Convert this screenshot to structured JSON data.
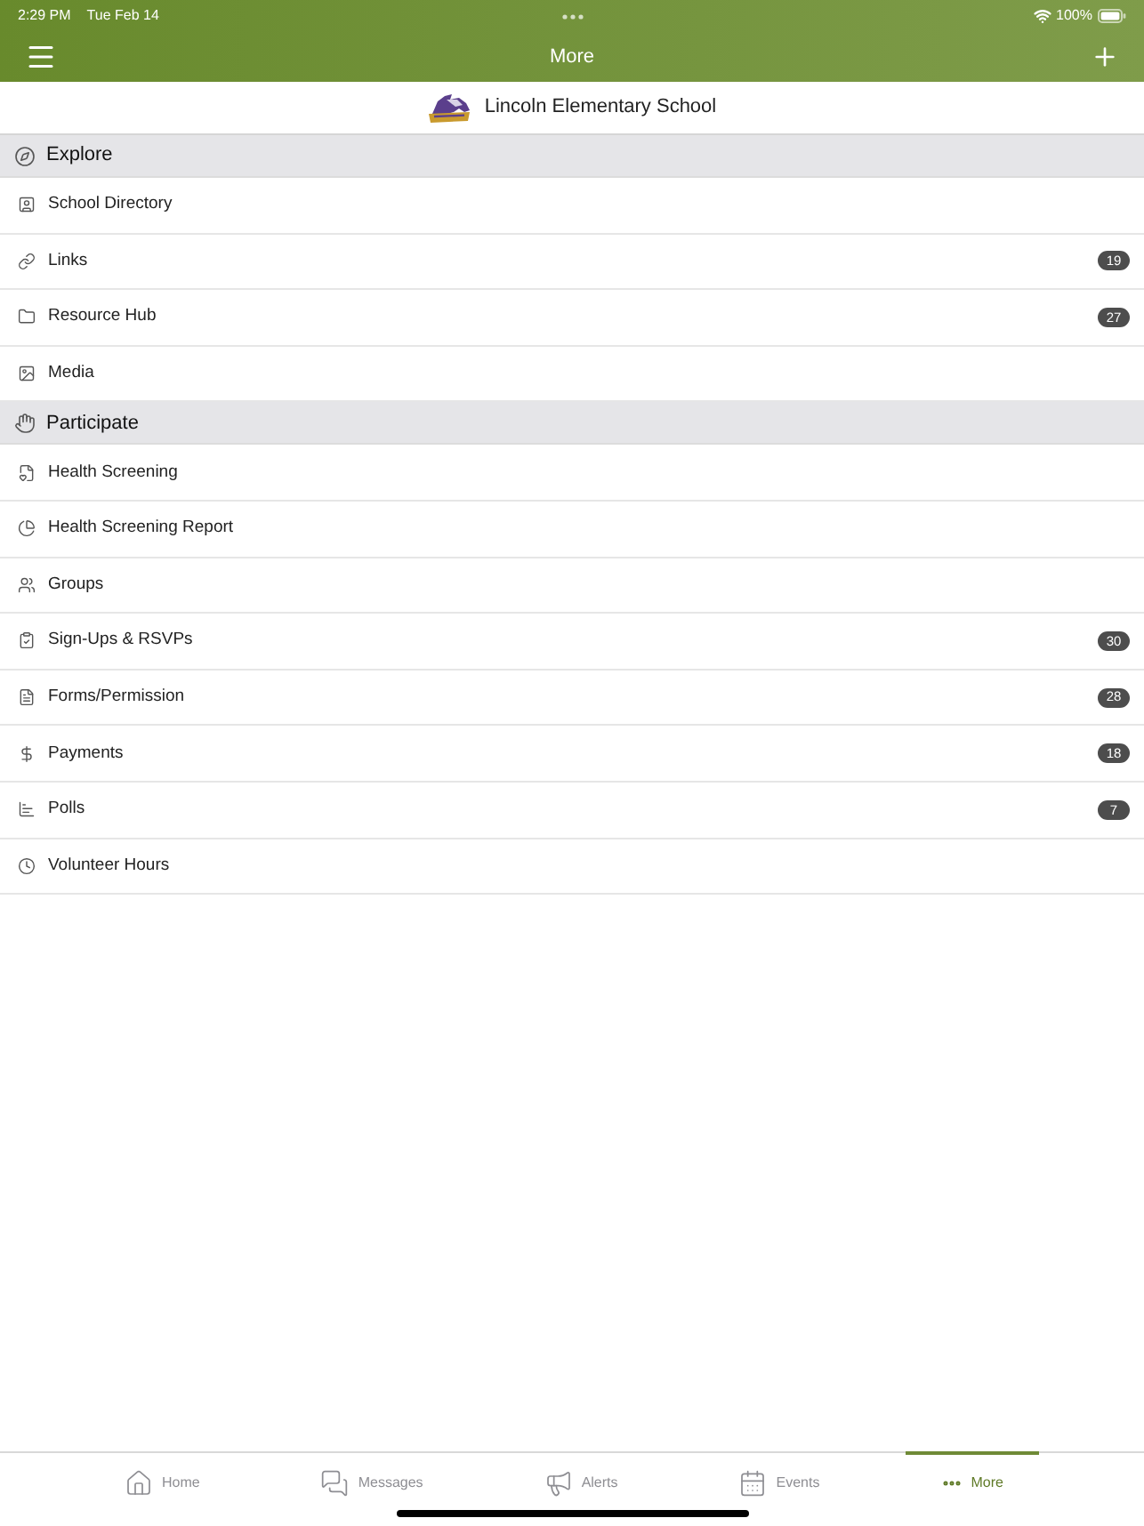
{
  "status_bar": {
    "time": "2:29 PM",
    "date": "Tue Feb 14",
    "battery": "100%"
  },
  "nav_bar": {
    "title": "More"
  },
  "school": {
    "name": "Lincoln Elementary School"
  },
  "sections": [
    {
      "title": "Explore",
      "items": [
        {
          "label": "School Directory"
        },
        {
          "label": "Links",
          "badge": "19"
        },
        {
          "label": "Resource Hub",
          "badge": "27"
        },
        {
          "label": "Media"
        }
      ]
    },
    {
      "title": "Participate",
      "items": [
        {
          "label": "Health Screening"
        },
        {
          "label": "Health Screening Report"
        },
        {
          "label": "Groups"
        },
        {
          "label": "Sign-Ups & RSVPs",
          "badge": "30"
        },
        {
          "label": "Forms/Permission",
          "badge": "28"
        },
        {
          "label": "Payments",
          "badge": "18"
        },
        {
          "label": "Polls",
          "badge": "7"
        },
        {
          "label": "Volunteer Hours"
        }
      ]
    }
  ],
  "tab_bar": {
    "tabs": [
      {
        "label": "Home",
        "selected": false
      },
      {
        "label": "Messages",
        "selected": false
      },
      {
        "label": "Alerts",
        "selected": false
      },
      {
        "label": "Events",
        "selected": false
      },
      {
        "label": "More",
        "selected": true
      }
    ]
  }
}
